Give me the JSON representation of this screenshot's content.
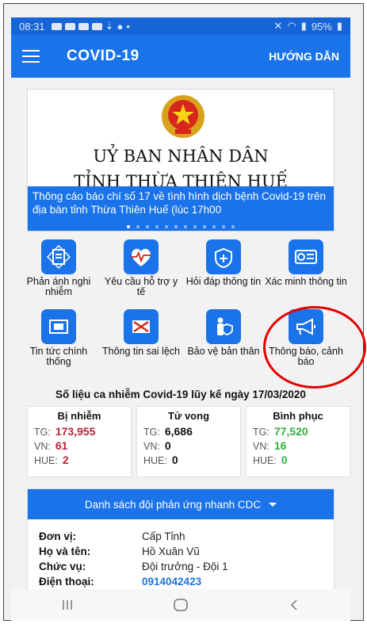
{
  "status_bar": {
    "time": "08:31",
    "battery": "95%"
  },
  "app_bar": {
    "title": "COVID-19",
    "help_label": "HƯỚNG DẪN"
  },
  "banner": {
    "title_line1": "UỶ BAN NHÂN DÂN",
    "title_line2": "TỈNH THỪA THIÊN HUẾ",
    "caption": "Thông cáo báo chí số 17 về tình hình dịch bệnh Covid-19 trên địa bàn tỉnh Thừa Thiên Huế (lúc 17h00"
  },
  "tiles": [
    {
      "label": "Phản ánh nghi nhiễm",
      "icon": "report-document-icon"
    },
    {
      "label": "Yêu cầu hỗ trợ y tế",
      "icon": "sos-heartbeat-icon"
    },
    {
      "label": "Hỏi đáp thông tin",
      "icon": "qa-shield-icon"
    },
    {
      "label": "Xác minh thông tin",
      "icon": "verify-card-icon"
    },
    {
      "label": "Tin tức chính thống",
      "icon": "news-icon"
    },
    {
      "label": "Thông tin sai lệch",
      "icon": "fake-news-icon"
    },
    {
      "label": "Bảo vệ bản thân",
      "icon": "self-protect-icon"
    },
    {
      "label": "Thông báo, cảnh báo",
      "icon": "megaphone-icon"
    }
  ],
  "stats": {
    "title": "Số liệu ca nhiễm Covid-19 lũy kế ngày 17/03/2020",
    "infected": {
      "header": "Bị nhiễm",
      "tg_label": "TG:",
      "tg": "173,955",
      "vn_label": "VN:",
      "vn": "61",
      "hue_label": "HUE:",
      "hue": "2"
    },
    "deaths": {
      "header": "Tử vong",
      "tg_label": "TG:",
      "tg": "6,686",
      "vn_label": "VN:",
      "vn": "0",
      "hue_label": "HUE:",
      "hue": "0"
    },
    "recovered": {
      "header": "Bình phục",
      "tg_label": "TG:",
      "tg": "77,520",
      "vn_label": "VN:",
      "vn": "16",
      "hue_label": "HUE:",
      "hue": "0"
    }
  },
  "cdc": {
    "dropdown_label": "Danh sách đội phản ứng nhanh CDC",
    "unit_label": "Đơn vị:",
    "unit": "Cấp Tỉnh",
    "name_label": "Họ và tên:",
    "name": "Hồ Xuân Vũ",
    "role_label": "Chức vụ:",
    "role": "Đội trưởng - Đội 1",
    "phone_label": "Điện thoại:",
    "phone": "0914042423"
  },
  "colors": {
    "primary": "#1a73e8",
    "infected": "#b3263a",
    "recovered": "#2fb33b",
    "highlight_circle": "#e30000"
  }
}
